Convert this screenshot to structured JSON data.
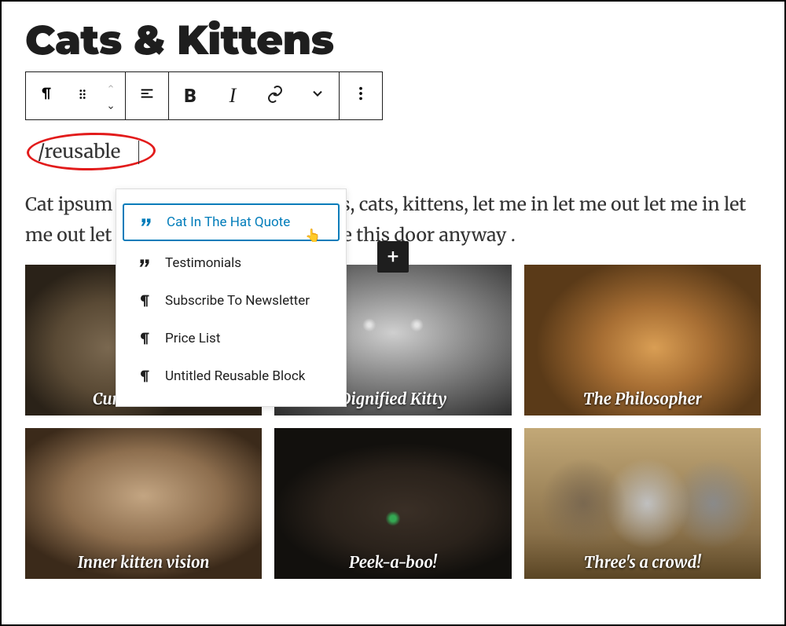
{
  "title": "Cats & Kittens",
  "toolbar": {
    "paragraph_icon": "paragraph",
    "drag_icon": "drag-handle",
    "moveup_icon": "chevron-up",
    "movedown_icon": "chevron-down",
    "align_icon": "align-left",
    "bold_label": "B",
    "italic_label": "I",
    "link_icon": "link",
    "more_icon": "chevron-down",
    "options_icon": "more-vertical"
  },
  "slash": {
    "text": "/reusable"
  },
  "autocomplete": {
    "items": [
      {
        "label": "Cat In The Hat Quote",
        "icon": "quote",
        "selected": true
      },
      {
        "label": "Testimonials",
        "icon": "quote",
        "selected": false
      },
      {
        "label": "Subscribe To Newsletter",
        "icon": "paragraph",
        "selected": false
      },
      {
        "label": "Price List",
        "icon": "paragraph",
        "selected": false
      },
      {
        "label": "Untitled Reusable Block",
        "icon": "paragraph",
        "selected": false
      }
    ]
  },
  "paragraph": "Cat ipsum dolor sit amet, cats, kittens, cats, kittens, let me in let me out let me in let me out let me in let me out who broke this door anyway .",
  "gallery": {
    "add_label": "+",
    "items": [
      {
        "caption": "Curious kitten",
        "img": "img-curious"
      },
      {
        "caption": "Dignified Kitty",
        "img": "img-dignified"
      },
      {
        "caption": "The Philosopher",
        "img": "img-philosopher"
      },
      {
        "caption": "Inner kitten vision",
        "img": "img-inner"
      },
      {
        "caption": "Peek-a-boo!",
        "img": "img-peek"
      },
      {
        "caption": "Three's a crowd!",
        "img": "img-crowd"
      }
    ]
  }
}
